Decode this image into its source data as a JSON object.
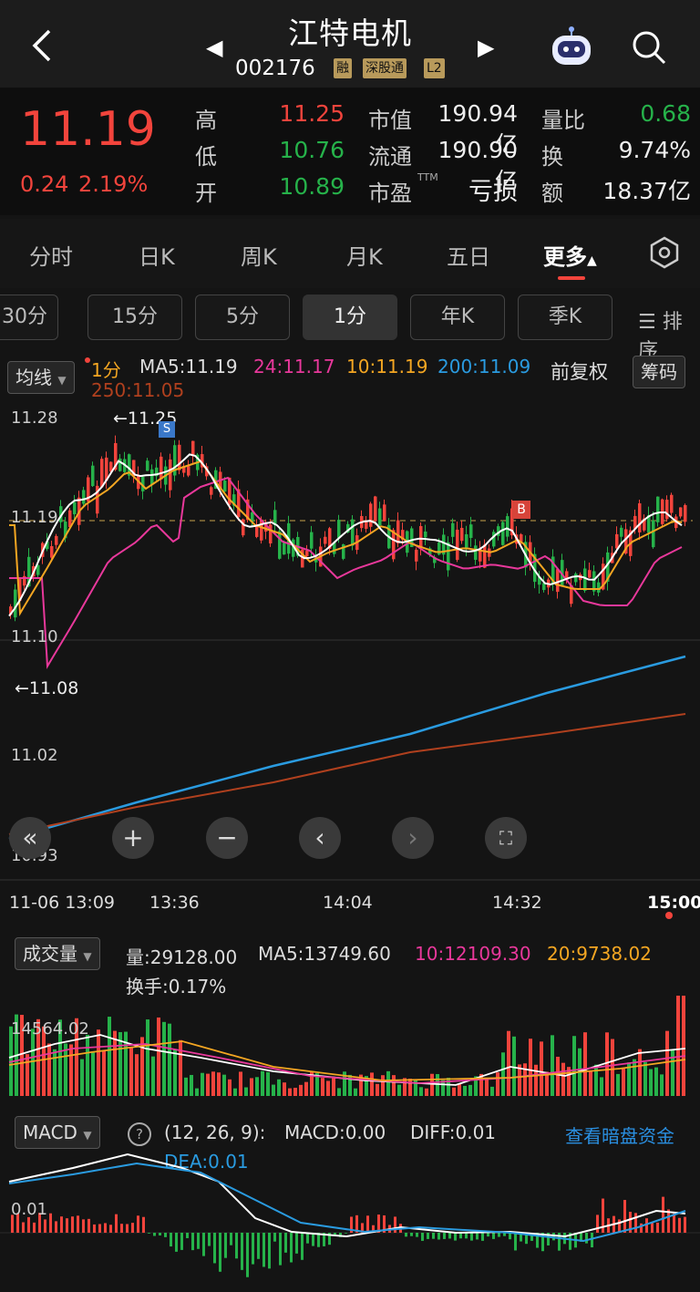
{
  "header": {
    "title": "江特电机",
    "code": "002176",
    "tags": [
      "融",
      "深股通",
      "L2"
    ]
  },
  "quote": {
    "price": "11.19",
    "change": "0.24",
    "change_pct": "2.19%",
    "labels": {
      "high": "高",
      "low": "低",
      "open": "开",
      "mcap": "市值",
      "float": "流通",
      "pe": "市盈",
      "vr": "量比",
      "turn": "换",
      "amt": "额"
    },
    "values": {
      "high": "11.25",
      "low": "10.76",
      "open": "10.89",
      "mcap": "190.94亿",
      "float": "190.90亿",
      "pe": "亏损",
      "pe_sup": "TTM",
      "vr": "0.68",
      "turn": "9.74%",
      "amt": "18.37亿"
    }
  },
  "tabs": [
    "分时",
    "日K",
    "周K",
    "月K",
    "五日",
    "更多"
  ],
  "subtabs": [
    "30分",
    "15分",
    "5分",
    "1分",
    "年K",
    "季K"
  ],
  "sort_label": "排序",
  "ma": {
    "selector": "均线",
    "period": "1分",
    "ma5": "MA5:11.19",
    "ma24": "24:11.17",
    "ma10": "10:11.19",
    "ma200": "200:11.09",
    "ma250": "250:11.05",
    "adjust": "前复权",
    "chips": "筹码"
  },
  "chart_data": [
    {
      "type": "candlestick",
      "title": "",
      "yticks": [
        "11.28",
        "11.19",
        "11.10",
        "11.02",
        "10.93"
      ],
      "ylim": [
        10.93,
        11.28
      ],
      "annotations": {
        "high": "←11.25",
        "low": "←11.08",
        "sell": "S",
        "buy": "B"
      },
      "xticks": [
        "11-06 13:09",
        "13:36",
        "14:04",
        "14:32",
        "15:00"
      ],
      "series": [
        {
          "name": "MA5",
          "color": "#ffffff"
        },
        {
          "name": "24",
          "color": "#e8389b"
        },
        {
          "name": "10",
          "color": "#f4a622"
        },
        {
          "name": "200",
          "color": "#2a9be0"
        },
        {
          "name": "250",
          "color": "#b0401e"
        }
      ]
    },
    {
      "type": "bar",
      "title": "",
      "ytick": "14564.02",
      "indicator": "成交量",
      "vol": "量:29128.00",
      "ma5": "MA5:13749.60",
      "ma10": "10:12109.30",
      "ma20": "20:9738.02",
      "turnover": "换手:0.17%"
    },
    {
      "type": "bar",
      "title": "",
      "ytick": "0.01",
      "indicator": "MACD",
      "params": "(12, 26, 9):",
      "macd": "MACD:0.00",
      "diff": "DIFF:0.01",
      "dea": "DEA:0.01",
      "link": "查看暗盘资金"
    }
  ],
  "colors": {
    "up": "#f2443c",
    "down": "#26b24a",
    "bg": "#141414"
  }
}
